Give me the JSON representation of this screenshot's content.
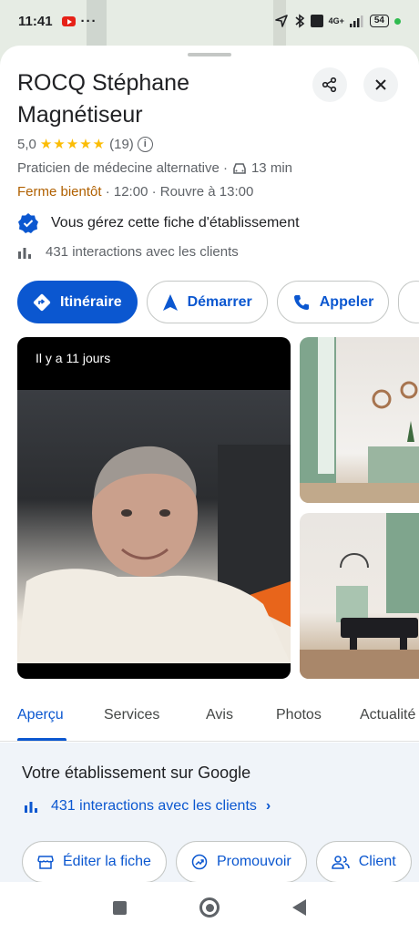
{
  "status_bar": {
    "time": "11:41",
    "dots": "···",
    "network": "4G+",
    "battery": "54"
  },
  "place": {
    "title_line1": "ROCQ Stéphane",
    "title_line2": "Magnétiseur",
    "rating": "5,0",
    "stars": "★★★★★",
    "reviews_count": "(19)",
    "category": "Praticien de médecine alternative ·",
    "drive_time": "13 min",
    "open_status": "Ferme bientôt",
    "hours_detail": " · 12:00 · Rouvre à 13:00",
    "manage_text": "Vous gérez cette fiche d'établissement",
    "interactions_text": "431 interactions avec les clients"
  },
  "actions": [
    {
      "label": "Itinéraire",
      "icon": "directions-icon"
    },
    {
      "label": "Démarrer",
      "icon": "navigation-arrow-icon"
    },
    {
      "label": "Appeler",
      "icon": "phone-icon"
    }
  ],
  "photos": {
    "main_label": "Il y a 11 jours"
  },
  "tabs": [
    "Aperçu",
    "Services",
    "Avis",
    "Photos",
    "Actualité"
  ],
  "owner": {
    "title": "Votre établissement sur Google",
    "link": "431 interactions avec les clients",
    "chips": [
      {
        "label": "Éditer la fiche",
        "icon": "storefront-icon"
      },
      {
        "label": "Promouvoir",
        "icon": "promote-icon"
      },
      {
        "label": "Client",
        "icon": "customers-icon"
      }
    ]
  },
  "colors": {
    "accent": "#0b57d0",
    "star": "#fbbc04",
    "warning": "#b06000",
    "owner_bg": "#f0f4f9"
  }
}
